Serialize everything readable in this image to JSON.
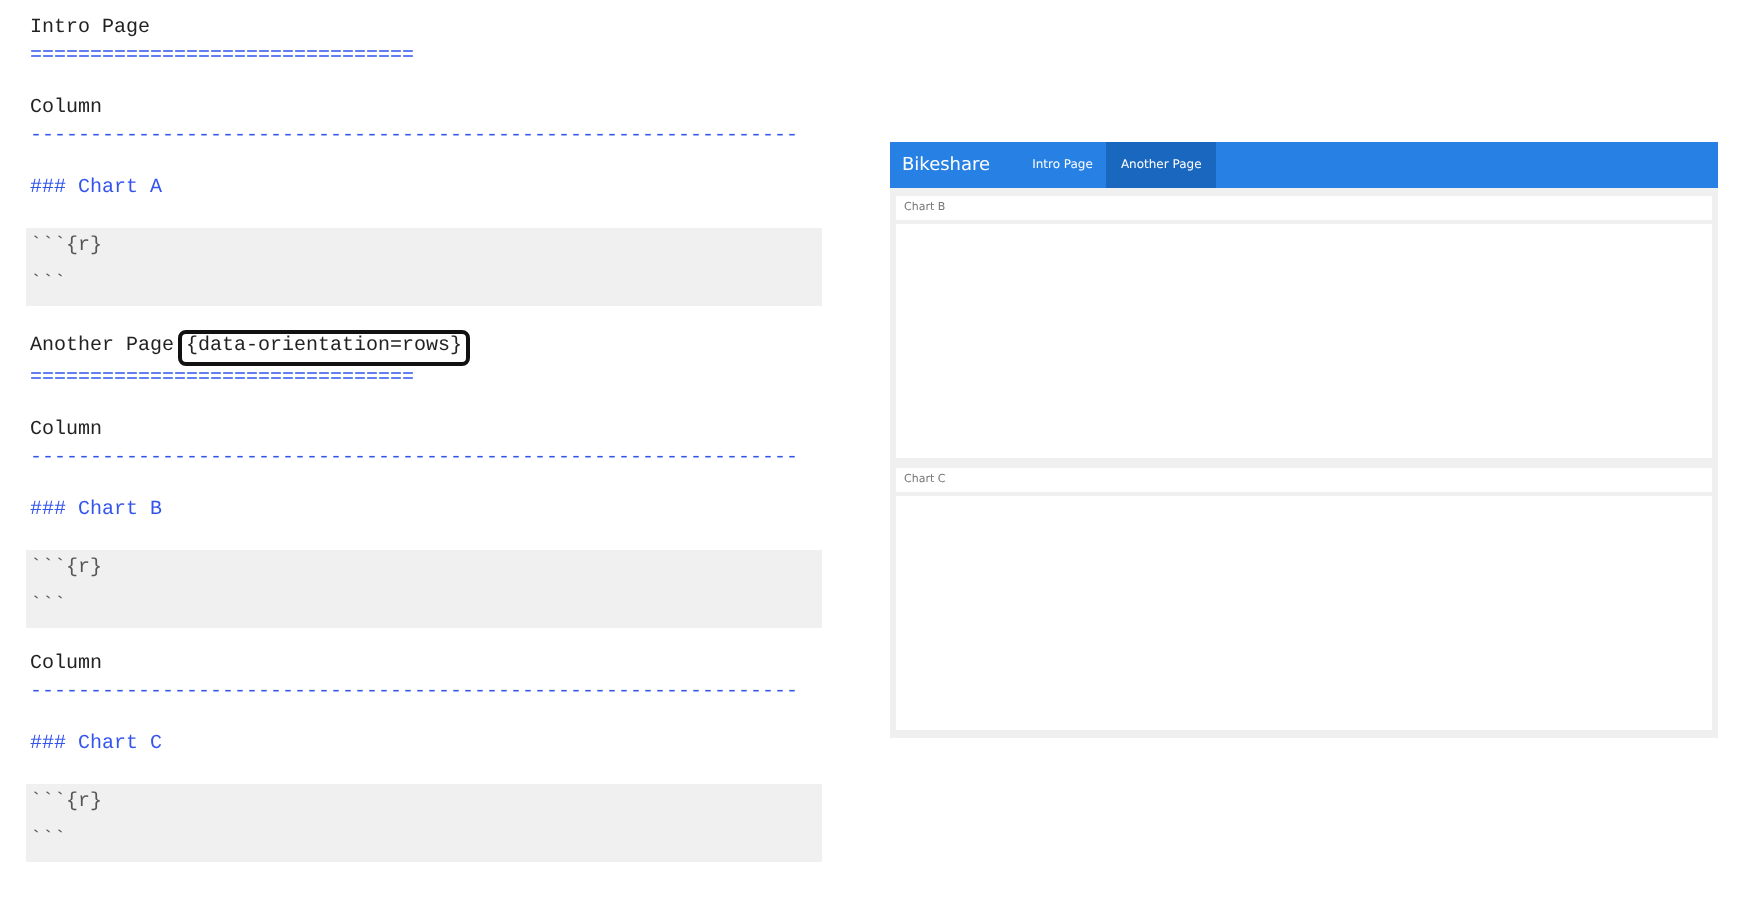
{
  "editor": {
    "blocks": [
      {
        "kind": "heading",
        "text": "Intro Page",
        "underline": "================================"
      },
      {
        "kind": "column",
        "text": "Column",
        "underline": "----------------------------------------------------------------"
      },
      {
        "kind": "chart",
        "text": "### Chart A"
      },
      {
        "kind": "code",
        "lines": [
          "```{r}",
          "```"
        ]
      },
      {
        "kind": "heading",
        "text": "Another Page",
        "attribute": {
          "text": "{data-orientation=rows}",
          "highlighted": true
        },
        "underline": "================================"
      },
      {
        "kind": "column",
        "text": "Column",
        "underline": "----------------------------------------------------------------"
      },
      {
        "kind": "chart",
        "text": "### Chart B"
      },
      {
        "kind": "code",
        "lines": [
          "```{r}",
          "```"
        ]
      },
      {
        "kind": "column",
        "text": "Column",
        "underline": "----------------------------------------------------------------"
      },
      {
        "kind": "chart",
        "text": "### Chart C"
      },
      {
        "kind": "code",
        "lines": [
          "```{r}",
          "```"
        ]
      }
    ]
  },
  "preview": {
    "navbar": {
      "brand": "Bikeshare",
      "tabs": [
        {
          "label": "Intro Page",
          "selected": false
        },
        {
          "label": "Another Page",
          "selected": true
        }
      ]
    },
    "cards": [
      {
        "title": "Chart B"
      },
      {
        "title": "Chart C"
      }
    ]
  }
}
